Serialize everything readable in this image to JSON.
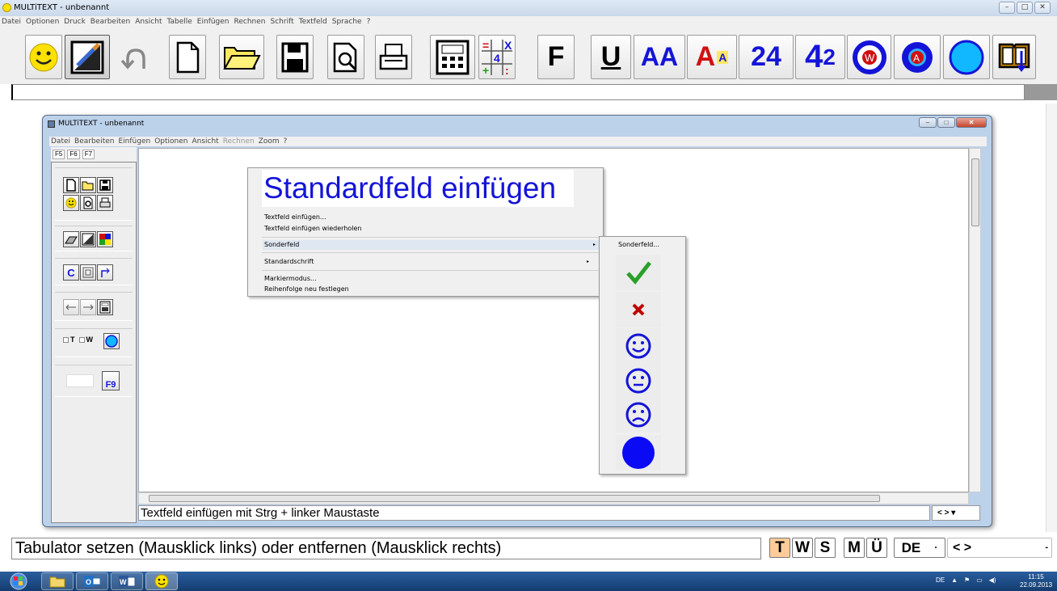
{
  "app": {
    "title": "MULTiTEXT - unbenannt"
  },
  "window_buttons": {
    "minimize": "–",
    "maximize": "□",
    "close": "✕"
  },
  "menu": [
    "Datei",
    "Optionen",
    "Druck",
    "Bearbeiten",
    "Ansicht",
    "Tabelle",
    "Einfügen",
    "Rechnen",
    "Schrift",
    "Textfeld",
    "Sprache",
    "?"
  ],
  "toolbar": {
    "bold_label": "F",
    "underline_label": "U",
    "font_larger_label": "AA",
    "font_colored_label": "A",
    "font_colored_small": "A",
    "num24_label": "24",
    "num42_left": "4",
    "num42_right": "2",
    "circle_w_label": "W",
    "circle_a_label": "A",
    "calc_plus": "+",
    "calc_eq": "=",
    "calc_x": "X",
    "calc_div": ":",
    "calc_four": "4"
  },
  "inner_window": {
    "title": "MULTiTEXT - unbenannt",
    "menu": [
      "Datei",
      "Bearbeiten",
      "Einfügen",
      "Optionen",
      "Ansicht",
      "Rechnen",
      "Zoom",
      "?"
    ],
    "tabs": [
      "F5",
      "F6",
      "F7"
    ],
    "panel": {
      "c_label": "C",
      "t_label": "T",
      "w_label": "W",
      "f9_label": "F9"
    },
    "status_left": "Textfeld einfügen mit Strg + linker Maustaste",
    "status_right": "< >  ▾"
  },
  "context_menu": {
    "title": "Standardfeld einfügen",
    "items": [
      "Textfeld einfügen...",
      "Textfeld einfügen wiederholen",
      "Sonderfeld",
      "Standardschrift",
      "Markiermodus...",
      "Reihenfolge neu festlegen"
    ],
    "submenu_arrow": "▸"
  },
  "submenu": {
    "header": "Sonderfeld...",
    "symbols": [
      "check",
      "cross",
      "smile",
      "neutral",
      "sad",
      "circle"
    ]
  },
  "bottom_status": {
    "text": "Tabulator setzen (Mausklick links) oder entfernen (Mausklick rechts)",
    "buttons": [
      "T",
      "W",
      "S",
      "M",
      "Ü"
    ],
    "lang": "DE",
    "lang_caret": "·",
    "nav": "< >",
    "nav_caret": "-"
  },
  "taskbar": {
    "lang": "DE",
    "time": "11:15",
    "date": "22.09.2013"
  },
  "colors": {
    "accent_blue": "#1414d8",
    "tab_active": "#ffcc99",
    "smiley_yellow": "#ffe100",
    "green_check": "#2aa02a",
    "red_cross": "#c00000"
  }
}
